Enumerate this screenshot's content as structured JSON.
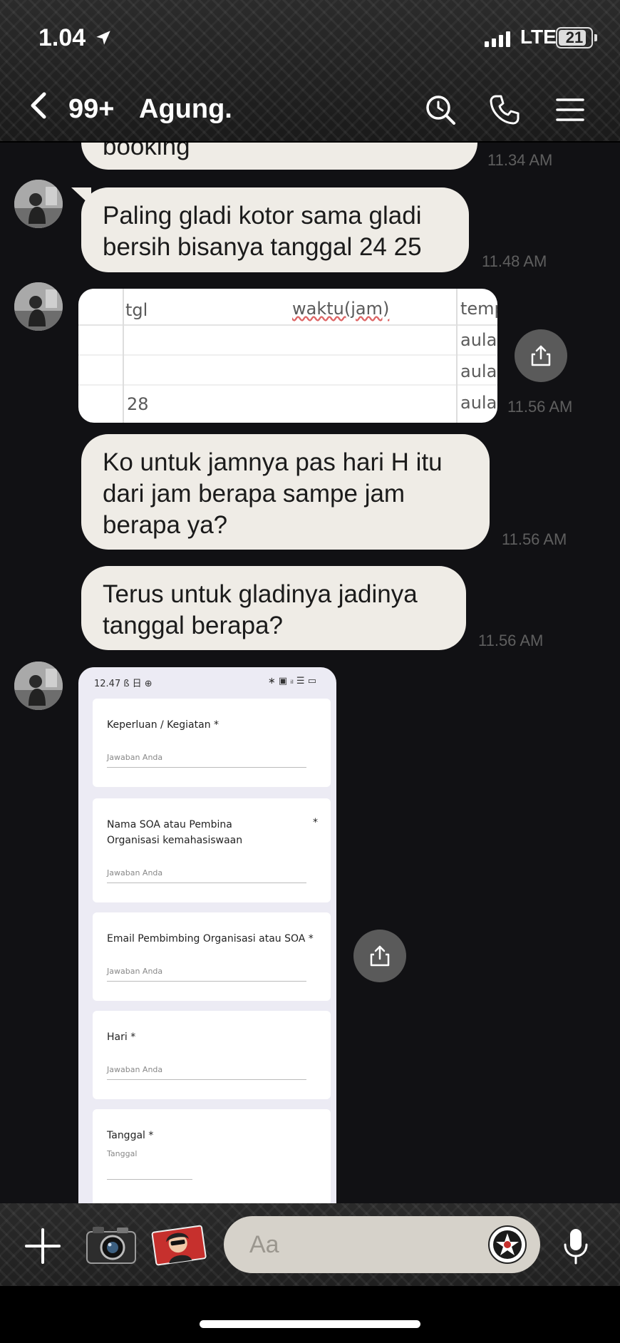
{
  "status_bar": {
    "time": "1.04",
    "network": "LTE",
    "battery": "21"
  },
  "header": {
    "unread_count": "99+",
    "chat_name": "Agung."
  },
  "messages": [
    {
      "text": "booking",
      "time": "11.34 AM"
    },
    {
      "text": "Paling gladi kotor sama gladi bersih bisanya tanggal 24 25",
      "line1": "Paling gladi kotor sama gladi",
      "line2": "bersih bisanya tanggal 24 25",
      "time": "11.48 AM"
    },
    {
      "type": "image",
      "time": "11.56 AM"
    },
    {
      "line1": "Ko untuk jamnya pas hari H itu",
      "line2": "dari jam berapa sampe jam",
      "line3": "berapa ya?",
      "time": "11.56 AM"
    },
    {
      "line1": "Terus untuk gladinya jadinya",
      "line2": "tanggal berapa?",
      "time": "11.56 AM"
    },
    {
      "type": "image"
    }
  ],
  "table_image": {
    "col_tgl": "tgl",
    "col_waktu": "waktu(jam)",
    "col_temp": "temp",
    "row_values": [
      "aula",
      "aula",
      "aula"
    ],
    "date": "28"
  },
  "form_image": {
    "status_left": "12.47 ß 日 ⊕",
    "status_right": "∗ ▣ ᵢₗ ☰ ▭",
    "fields": [
      {
        "question": "Keperluan / Kegiatan *",
        "answer": "Jawaban Anda"
      },
      {
        "question": "Nama SOA atau Pembina Organisasi kemahasiswaan",
        "answer": "Jawaban Anda",
        "star": "*"
      },
      {
        "question": "Email Pembimbing Organisasi atau SOA *",
        "answer": "Jawaban Anda"
      },
      {
        "question": "Hari *",
        "answer": "Jawaban Anda"
      },
      {
        "question": "Tanggal *",
        "answer": "Tanggal"
      }
    ]
  },
  "composer": {
    "placeholder": "Aa"
  },
  "colors": {
    "bubble": "#efece6",
    "background": "#111114",
    "time": "#5f5f5f"
  }
}
